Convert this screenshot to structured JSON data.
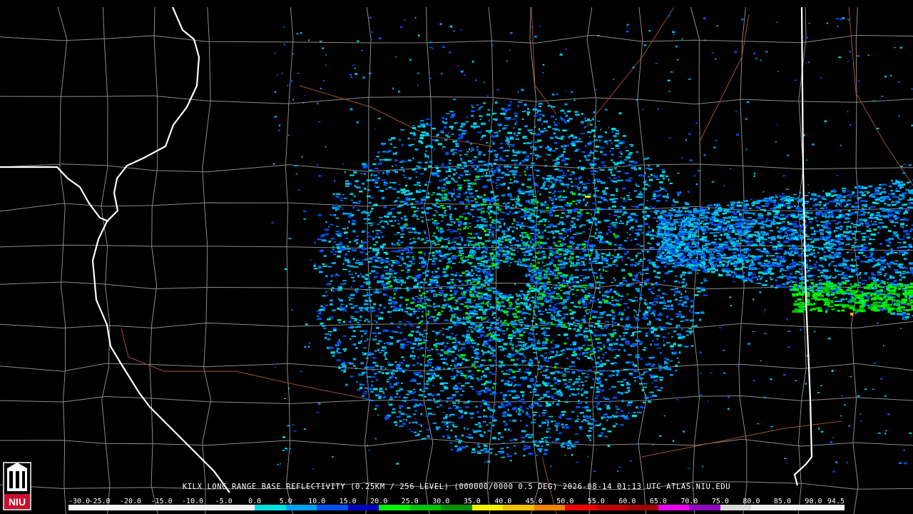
{
  "caption": "KILX LONG RANGE BASE REFLECTIVITY (0.25KM / 256 LEVEL) (000000/0000 0.5 DEG) 2026-08-14 01:13 UTC  ATLAS.NIU.EDU",
  "logo": {
    "icon": "niu-logo-icon",
    "text": "NIU",
    "color": "#c8102e"
  },
  "scale": {
    "labels": [
      "-30.0",
      "-25.0",
      "-20.0",
      "-15.0",
      "-10.0",
      "-5.0",
      "0.0",
      "5.0",
      "10.0",
      "15.0",
      "20.0",
      "25.0",
      "30.0",
      "35.0",
      "40.0",
      "45.0",
      "50.0",
      "55.0",
      "60.0",
      "65.0",
      "70.0",
      "75.0",
      "80.0",
      "85.0",
      "90.0",
      "94.5"
    ],
    "colors": [
      "#f8f8f8",
      "#f6f6f6",
      "#f4f4f4",
      "#f2f2f2",
      "#f0f0f0",
      "#eeeeee",
      "#00e0e0",
      "#00a0f0",
      "#0050f0",
      "#0000c0",
      "#00f000",
      "#00c000",
      "#009000",
      "#f0f000",
      "#f0c000",
      "#f08000",
      "#f00000",
      "#c00000",
      "#a00000",
      "#f000f0",
      "#9000c0",
      "#d8d8d8",
      "#f0f0f0",
      "#f4f4f4",
      "#f8f8f8"
    ]
  },
  "map_colors": {
    "county_lines": "#8a8a8a",
    "state_lines": "#ffffff",
    "highways": "#a05030"
  },
  "radar": {
    "site": "KILX",
    "product": "base-reflectivity"
  }
}
